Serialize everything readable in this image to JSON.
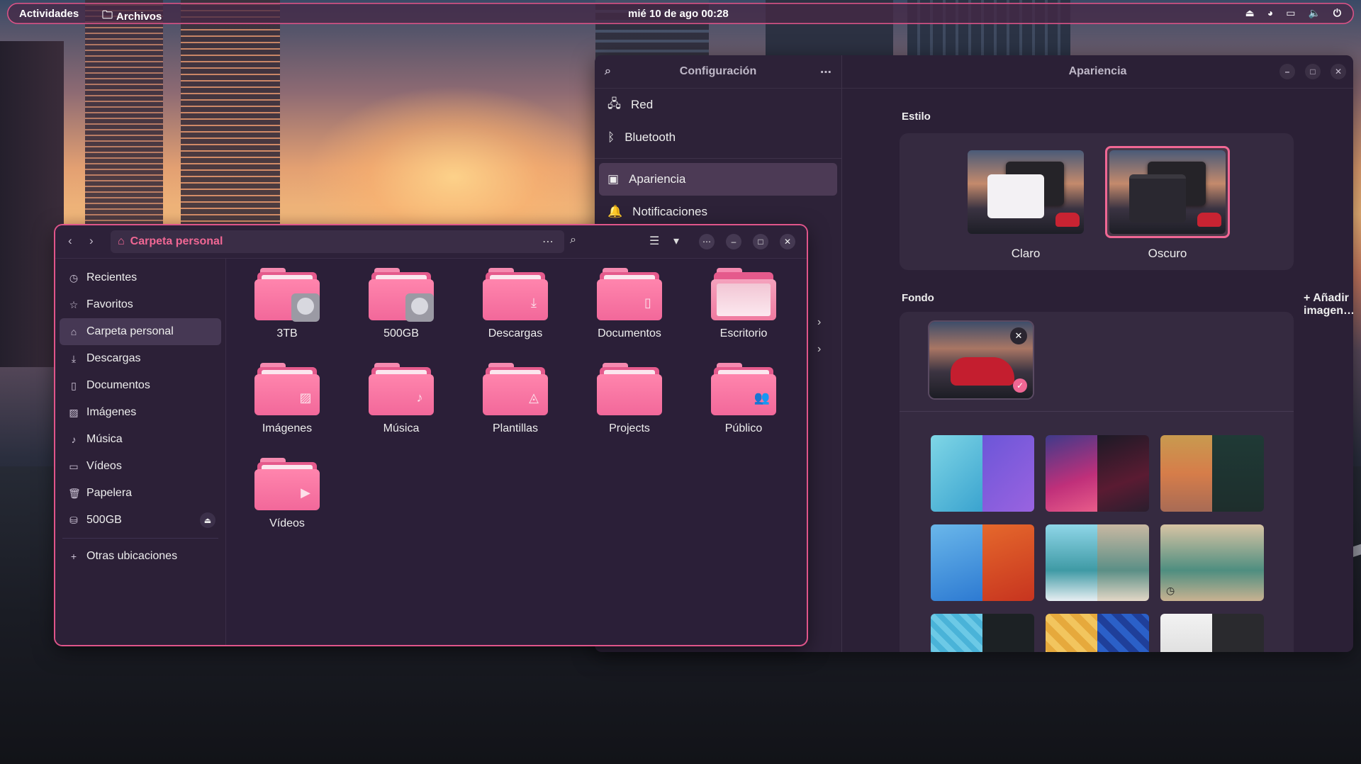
{
  "topbar": {
    "activities": "Actividades",
    "app_name": "Archivos",
    "clock": "mié 10 de ago  00:28"
  },
  "settings": {
    "sidebar_title": "Configuración",
    "items": [
      {
        "label": "Red",
        "icon": "network-icon"
      },
      {
        "label": "Bluetooth",
        "icon": "bluetooth-icon"
      },
      {
        "label": "Apariencia",
        "icon": "appearance-icon",
        "active": true
      },
      {
        "label": "Notificaciones",
        "icon": "bell-icon"
      }
    ],
    "main_title": "Apariencia",
    "style_label": "Estilo",
    "style_options": [
      {
        "label": "Claro"
      },
      {
        "label": "Oscuro",
        "selected": true
      }
    ],
    "background_label": "Fondo",
    "add_image": "Añadir imagen…"
  },
  "files": {
    "path": "Carpeta personal",
    "sidebar": [
      {
        "label": "Recientes",
        "icon": "clock-icon"
      },
      {
        "label": "Favoritos",
        "icon": "star-icon"
      },
      {
        "label": "Carpeta personal",
        "icon": "home-icon",
        "active": true
      },
      {
        "label": "Descargas",
        "icon": "download-icon"
      },
      {
        "label": "Documentos",
        "icon": "document-icon"
      },
      {
        "label": "Imágenes",
        "icon": "image-icon"
      },
      {
        "label": "Música",
        "icon": "music-icon"
      },
      {
        "label": "Vídeos",
        "icon": "video-icon"
      },
      {
        "label": "Papelera",
        "icon": "trash-icon"
      },
      {
        "label": "500GB",
        "icon": "drive-icon"
      },
      {
        "label": "Otras ubicaciones",
        "icon": "plus-icon"
      }
    ],
    "folders": [
      "3TB",
      "500GB",
      "Descargas",
      "Documentos",
      "Escritorio",
      "Imágenes",
      "Música",
      "Plantillas",
      "Projects",
      "Público",
      "Vídeos"
    ]
  },
  "colors": {
    "accent": "#f06794",
    "window_bg": "#2b1f38",
    "folder": "#f2689a"
  }
}
